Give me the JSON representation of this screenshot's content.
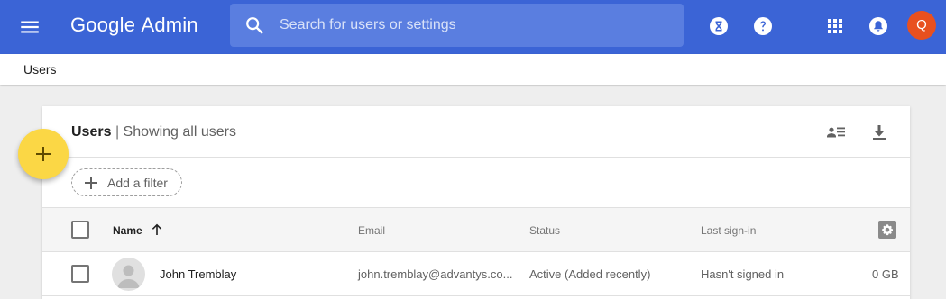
{
  "app": {
    "logo_google": "Google",
    "logo_admin": "Admin",
    "search_placeholder": "Search for users or settings",
    "avatar_letter": "Q"
  },
  "breadcrumb": {
    "label": "Users"
  },
  "card": {
    "title": "Users",
    "separator": "|",
    "subtitle": "Showing all users",
    "filter_label": "Add a filter"
  },
  "table": {
    "columns": {
      "name": "Name",
      "email": "Email",
      "status": "Status",
      "last_signin": "Last sign-in"
    },
    "rows": [
      {
        "name": "John Tremblay",
        "email": "john.tremblay@advantys.co...",
        "status": "Active (Added recently)",
        "last_signin": "Hasn't signed in",
        "storage": "0 GB"
      }
    ]
  },
  "icons": {
    "menu": "menu-icon",
    "search": "search-icon",
    "timer": "hourglass-icon",
    "help": "help-icon",
    "apps": "apps-grid-icon",
    "notifications": "bell-icon",
    "user_list": "user-list-icon",
    "download": "download-icon",
    "sort": "arrow-up-icon",
    "settings": "gear-icon",
    "add": "plus-icon"
  },
  "colors": {
    "appbar": "#3b64d6",
    "search_bg": "#5a7ee0",
    "avatar": "#e8501f",
    "fab": "#fbd745"
  }
}
